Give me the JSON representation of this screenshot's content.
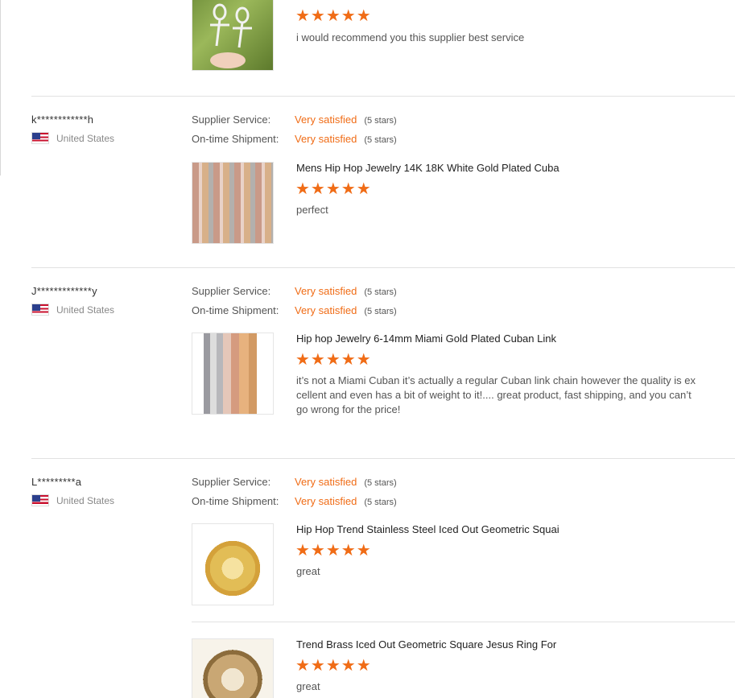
{
  "labels": {
    "supplier_service": "Supplier Service:",
    "ontime_shipment": "On-time Shipment:"
  },
  "stars_text": "★★★★★",
  "review0": {
    "comment": "i would recommend you this supplier best service"
  },
  "review1": {
    "name": "k************h",
    "country": "United States",
    "supplier_value": "Very satisfied",
    "supplier_stars": "(5 stars)",
    "shipment_value": "Very satisfied",
    "shipment_stars": "(5 stars)",
    "product_title": "Mens Hip Hop Jewelry 14K 18K White Gold Plated Cuba",
    "product_rating": 5,
    "comment": "perfect"
  },
  "review2": {
    "name": "J*************y",
    "country": "United States",
    "supplier_value": "Very satisfied",
    "supplier_stars": "(5 stars)",
    "shipment_value": "Very satisfied",
    "shipment_stars": "(5 stars)",
    "product_title": "Hip hop Jewelry 6-14mm Miami Gold Plated Cuban Link",
    "product_rating": 5,
    "comment": "it’s not a Miami Cuban it’s actually a regular Cuban link chain however the quality is excellent and even has a bit of weight to it!.... great product, fast shipping, and you can’t go wrong for the price!"
  },
  "review3": {
    "name": "L*********a",
    "country": "United States",
    "supplier_value": "Very satisfied",
    "supplier_stars": "(5 stars)",
    "shipment_value": "Very satisfied",
    "shipment_stars": "(5 stars)",
    "products": [
      {
        "title": "Hip Hop Trend Stainless Steel Iced Out Geometric Squai",
        "rating": 5,
        "comment": "great"
      },
      {
        "title": "Trend Brass Iced Out Geometric Square Jesus Ring For",
        "rating": 5,
        "comment": "great"
      }
    ]
  },
  "colors": {
    "accent": "#f06c16",
    "divider": "#e2e2e2"
  }
}
